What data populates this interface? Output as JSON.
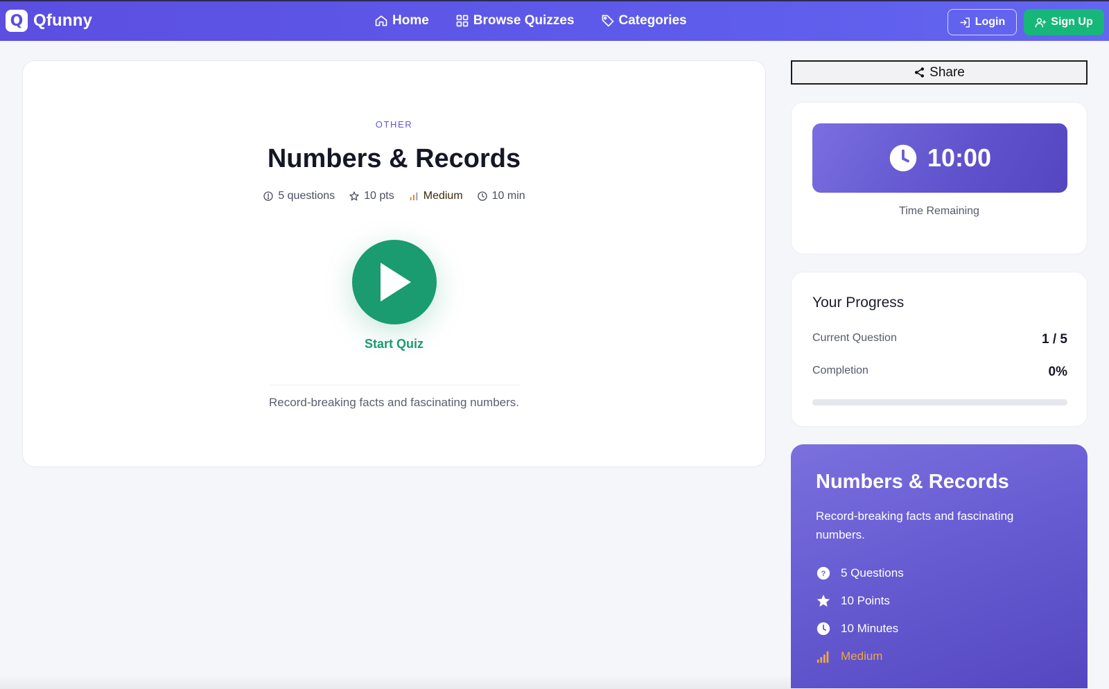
{
  "nav": {
    "brand_name": "Qfunny",
    "brand_letter": "Q",
    "links": [
      {
        "label": "Home",
        "icon": "home-icon"
      },
      {
        "label": "Browse Quizzes",
        "icon": "grid-icon"
      },
      {
        "label": "Categories",
        "icon": "tag-icon"
      }
    ],
    "login_label": "Login",
    "signup_label": "Sign Up"
  },
  "quiz": {
    "category": "OTHER",
    "title": "Numbers & Records",
    "meta": {
      "questions": "5 questions",
      "points": "10 pts",
      "difficulty": "Medium",
      "duration": "10 min"
    },
    "start_label": "Start Quiz",
    "description": "Record-breaking facts and fascinating numbers."
  },
  "sidebar": {
    "share_label": "Share",
    "timer": {
      "value": "10:00",
      "caption": "Time Remaining"
    },
    "progress": {
      "title": "Your Progress",
      "current_question_label": "Current Question",
      "current_question_value": "1 / 5",
      "completion_label": "Completion",
      "completion_value": "0%",
      "completion_fraction": 0
    },
    "info": {
      "title": "Numbers & Records",
      "description": "Record-breaking facts and fascinating numbers.",
      "items": [
        {
          "label": "5 Questions",
          "icon": "question-circle-icon"
        },
        {
          "label": "10 Points",
          "icon": "star-icon"
        },
        {
          "label": "10 Minutes",
          "icon": "clock-icon"
        },
        {
          "label": "Medium",
          "icon": "signal-bars-icon"
        }
      ]
    }
  },
  "colors": {
    "brand": "#5b4ee0",
    "success": "#1a9b70",
    "signup": "#16b779",
    "accent": "#5b57d6",
    "medium": "#f0a640"
  }
}
